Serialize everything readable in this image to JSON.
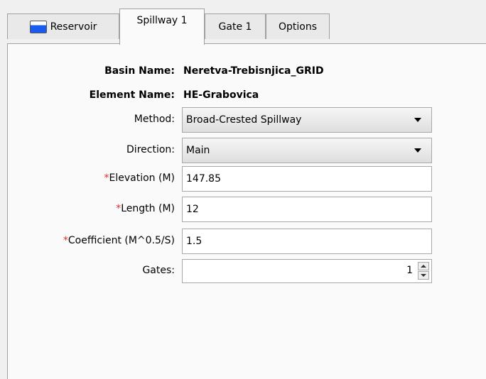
{
  "tabs": [
    {
      "label": "Reservoir",
      "icon": "reservoir-icon"
    },
    {
      "label": "Spillway 1"
    },
    {
      "label": "Gate 1"
    },
    {
      "label": "Options"
    }
  ],
  "active_tab": "Spillway 1",
  "form": {
    "basin_name_label": "Basin Name:",
    "basin_name_value": "Neretva-Trebisnjica_GRID",
    "element_name_label": "Element Name:",
    "element_name_value": "HE-Grabovica",
    "method_label": "Method:",
    "method_value": "Broad-Crested Spillway",
    "direction_label": "Direction:",
    "direction_value": "Main",
    "required_marker": "*",
    "elevation_label": "Elevation (M)",
    "elevation_value": "147.85",
    "length_label": "Length (M)",
    "length_value": "12",
    "coefficient_label": "Coefficient (M^0.5/S)",
    "coefficient_value": "1.5",
    "gates_label": "Gates:",
    "gates_value": "1"
  },
  "colors": {
    "required": "#e03030",
    "panel": "#fafafa",
    "background": "#f0f0f0"
  }
}
